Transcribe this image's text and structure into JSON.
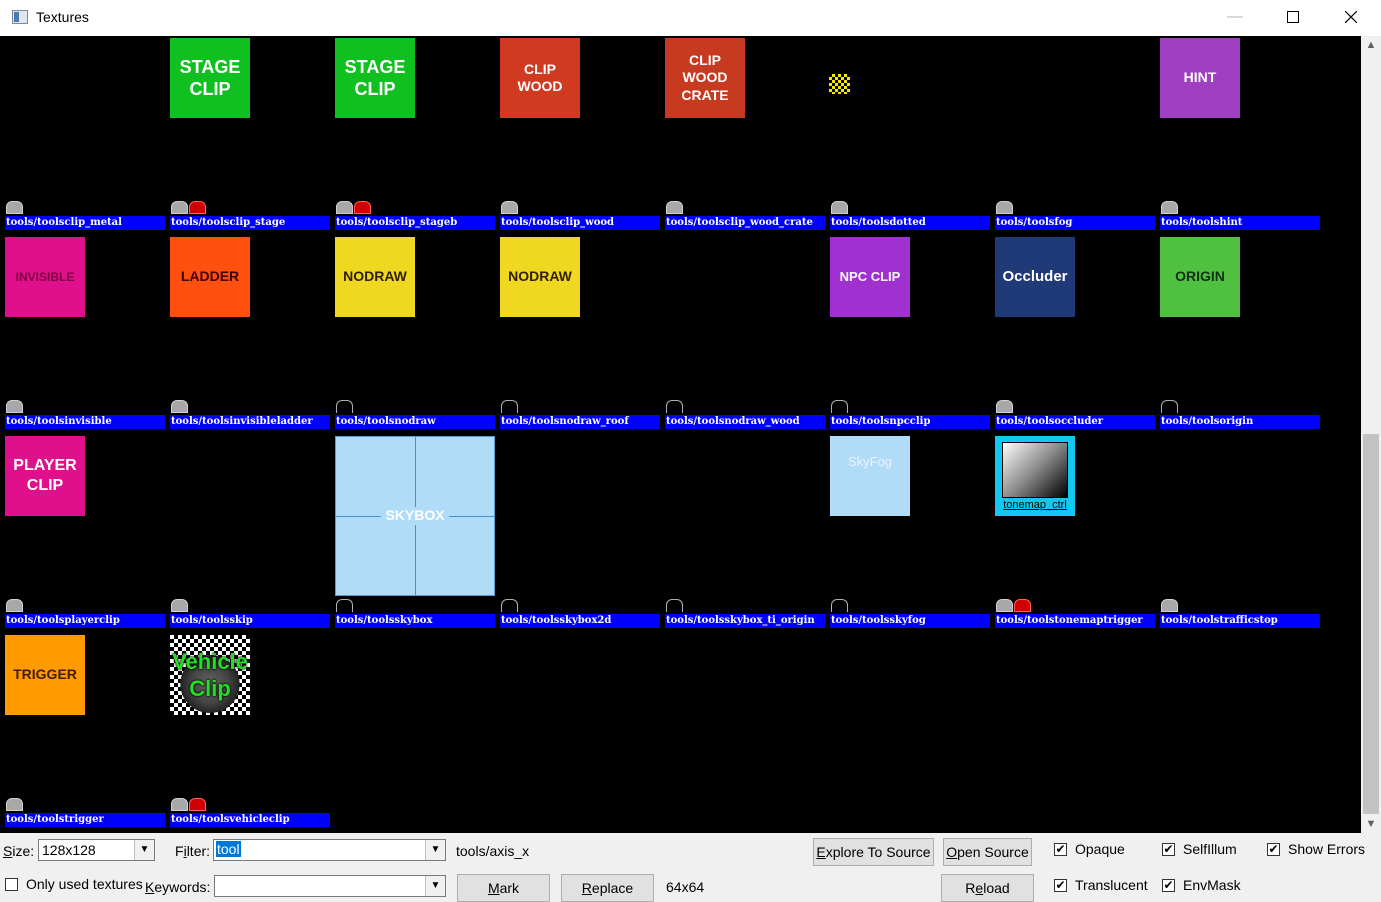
{
  "window": {
    "title": "Textures",
    "min_label": "—",
    "max_label": "☐",
    "close_label": "✕"
  },
  "tiles": [
    {
      "label": "tools/toolsclip_metal",
      "badges": [
        "t"
      ],
      "swatch": null
    },
    {
      "label": "tools/toolsclip_stage",
      "badges": [
        "t",
        "r"
      ],
      "swatch": {
        "text": "STAGE\nCLIP",
        "bg": "#10c020",
        "fg": "#ffffff",
        "size": 18
      }
    },
    {
      "label": "tools/toolsclip_stageb",
      "badges": [
        "t",
        "r"
      ],
      "swatch": {
        "text": "STAGE\nCLIP",
        "bg": "#10c020",
        "fg": "#ffffff",
        "size": 18
      }
    },
    {
      "label": "tools/toolsclip_wood",
      "badges": [
        "t"
      ],
      "swatch": {
        "text": "CLIP\nWOOD",
        "bg": "#d03a20",
        "fg": "#ffffff",
        "size": 14
      }
    },
    {
      "label": "tools/toolsclip_wood_crate",
      "badges": [
        "t"
      ],
      "swatch": {
        "text": "CLIP\nWOOD\nCRATE",
        "bg": "#c83a20",
        "fg": "#ffffff",
        "size": 14
      }
    },
    {
      "label": "tools/toolsdotted",
      "badges": [
        "t"
      ],
      "swatch": null
    },
    {
      "label": "tools/toolsfog",
      "badges": [
        "t"
      ],
      "swatch": null
    },
    {
      "label": "tools/toolshint",
      "badges": [
        "t"
      ],
      "swatch": {
        "text": "HINT",
        "bg": "#a040c0",
        "fg": "#ffffff",
        "size": 14
      }
    },
    {
      "label": "tools/toolsinvisible",
      "badges": [
        "t"
      ],
      "swatch": {
        "text": "INVISIBLE",
        "bg": "#e0108c",
        "fg": "#800040",
        "size": 12
      }
    },
    {
      "label": "tools/toolsinvisibleladder",
      "badges": [
        "t"
      ],
      "swatch": {
        "text": "LADDER",
        "bg": "#ff5010",
        "fg": "#400000",
        "size": 14
      }
    },
    {
      "label": "tools/toolsnodraw",
      "badges": [
        "o"
      ],
      "swatch": {
        "text": "NODRAW",
        "bg": "#f0d820",
        "fg": "#302000",
        "size": 14
      }
    },
    {
      "label": "tools/toolsnodraw_roof",
      "badges": [
        "o"
      ],
      "swatch": {
        "text": "NODRAW",
        "bg": "#f0d820",
        "fg": "#302000",
        "size": 14
      }
    },
    {
      "label": "tools/toolsnodraw_wood",
      "badges": [
        "o"
      ],
      "swatch": null
    },
    {
      "label": "tools/toolsnpcclip",
      "badges": [
        "o"
      ],
      "swatch": {
        "text": "NPC CLIP",
        "bg": "#a030d0",
        "fg": "#ffffff",
        "size": 13
      }
    },
    {
      "label": "tools/toolsoccluder",
      "badges": [
        "t"
      ],
      "swatch": {
        "text": "Occluder",
        "bg": "#203a78",
        "fg": "#ffffff",
        "size": 15
      }
    },
    {
      "label": "tools/toolsorigin",
      "badges": [
        "o"
      ],
      "swatch": {
        "text": "ORIGIN",
        "bg": "#50c040",
        "fg": "#103010",
        "size": 14
      }
    },
    {
      "label": "tools/toolsplayerclip",
      "badges": [
        "t"
      ],
      "swatch": {
        "text": "PLAYER\nCLIP",
        "bg": "#e0108c",
        "fg": "#ffffff",
        "size": 16
      }
    },
    {
      "label": "tools/toolsskip",
      "badges": [
        "t"
      ],
      "swatch": null
    },
    {
      "label": "tools/toolsskybox",
      "badges": [
        "o"
      ],
      "swatch": {
        "text": "SKYBOX",
        "bg": "#b0dcf8",
        "fg": "#ffffff",
        "size": 14,
        "big": true,
        "cross": true
      }
    },
    {
      "label": "tools/toolsskybox2d",
      "badges": [
        "o"
      ],
      "swatch": null
    },
    {
      "label": "tools/toolsskybox_ti_origin",
      "badges": [
        "o"
      ],
      "swatch": null
    },
    {
      "label": "tools/toolsskyfog",
      "badges": [
        "o"
      ],
      "swatch": {
        "text": "SkyFog",
        "bg": "#b0dcf8",
        "fg": "#e8f4ff",
        "size": 13,
        "align": "top"
      }
    },
    {
      "label": "tools/toolstonemaptrigger",
      "badges": [
        "t",
        "r"
      ],
      "swatch": {
        "text": "tonemap_ctrl",
        "gradient": true,
        "size": 11
      }
    },
    {
      "label": "tools/toolstrafficstop",
      "badges": [
        "t"
      ],
      "swatch": null
    },
    {
      "label": "tools/toolstrigger",
      "badges": [
        "t"
      ],
      "swatch": {
        "text": "TRIGGER",
        "bg": "#ff9a00",
        "fg": "#402000",
        "size": 14
      }
    },
    {
      "label": "tools/toolsvehicleclip",
      "badges": [
        "t",
        "r"
      ],
      "swatch": {
        "text": "Vehicle\nClip",
        "vehicle": true,
        "fg": "#20e020",
        "size": 22
      }
    }
  ],
  "controls": {
    "size_label": "Size:",
    "size_value": "128x128",
    "filter_label": "Filter:",
    "filter_value": "tool",
    "current_texture": "tools/axis_x",
    "only_used_label": "Only used textures",
    "only_used_checked": false,
    "keywords_label": "Keywords:",
    "keywords_value": "",
    "explore_label": "Explore To Source",
    "open_source_label": "Open Source",
    "mark_label": "Mark",
    "replace_label": "Replace",
    "reload_label": "Reload",
    "texture_size": "64x64",
    "opaque_label": "Opaque",
    "opaque_checked": true,
    "translucent_label": "Translucent",
    "translucent_checked": true,
    "selfillum_label": "SelfIllum",
    "selfillum_checked": true,
    "envmask_label": "EnvMask",
    "envmask_checked": true,
    "show_errors_label": "Show Errors",
    "show_errors_checked": true
  }
}
